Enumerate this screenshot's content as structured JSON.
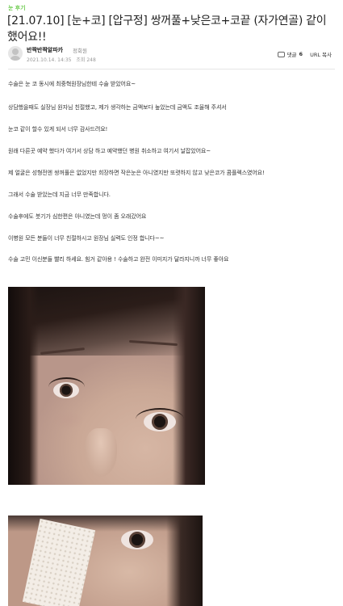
{
  "post": {
    "category": "눈 후기",
    "title": "[21.07.10] [눈+코] [압구정] 쌍꺼풀+낮은코+코끝 (자가연골) 같이 했어요!!",
    "author": "반짝반짝알파카",
    "grade": "정회원",
    "date": "2021.10.14. 14:35",
    "views": "조회 248",
    "comment_label": "댓글",
    "comment_count": "6",
    "url_copy": "URL 복사",
    "paragraphs": [
      "수술은 눈 코 동시에 최중혁원장님한테 수술 받았어요~",
      "상담했을때도 실장님 원자님 친절했고, 제가 생각하는 금액보다 높았는데 금액도 조율해 주셔서",
      "눈코 같이 할수 있게 되서 너무 감사드려요!",
      "원래 다른곳 예약 했다가 여기서 상담 하고 예약했던 병원 취소하고 여기서 날잡았어요~",
      "제 얼굴은 성형전엔 쌍꺼풀은 없었지만 희장하면 작은눈은 아니였지만 또렷하지 않고 낮은코가 콤플렉스였어요!",
      "그래서 수술 받았는데 지금 너무 만족합니다.",
      "수술후에도 붓기가 심한편은 아니였는데 멍이 좀 오래갔어요",
      "이병원 모든 분들이 너무 친절하시고 원장님 실력도 인정 합니다~~",
      "수술 고민 이신분들 빨리 하세요. 힘거 같아용 ! 수술하고 완전 이미지가 달라지니까 너무 좋아요"
    ]
  }
}
